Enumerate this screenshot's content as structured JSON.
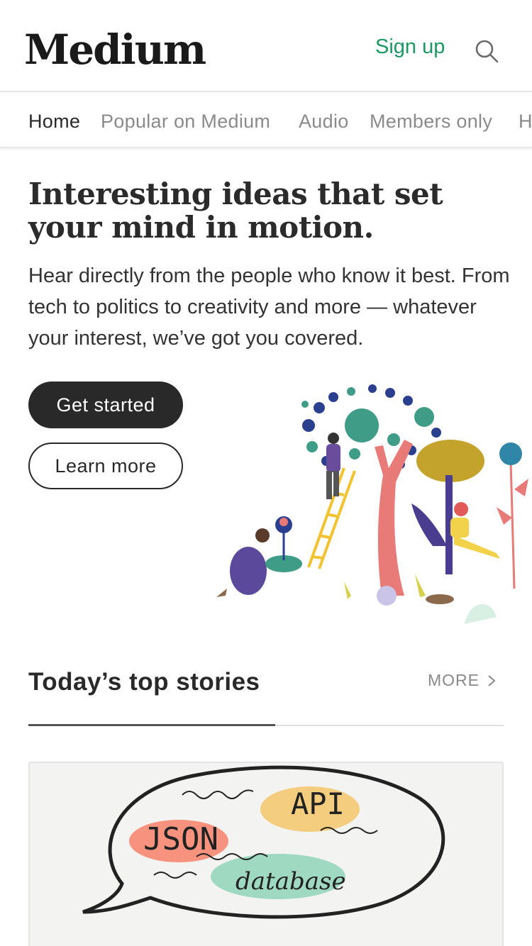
{
  "header": {
    "logo": "Medium",
    "signup_label": "Sign up",
    "search_icon": "search-icon"
  },
  "nav": {
    "items": [
      {
        "label": "Home",
        "active": true
      },
      {
        "label": "Popular on Medium",
        "active": false
      },
      {
        "label": "Audio",
        "active": false
      },
      {
        "label": "Members only",
        "active": false
      },
      {
        "label": "H",
        "active": false
      }
    ]
  },
  "hero": {
    "title": "Interesting ideas that set your mind in motion.",
    "subtitle": "Hear directly from the people who know it best. From tech to politics to creativity and more — whatever your interest, we’ve got you covered.",
    "primary_button": "Get started",
    "secondary_button": "Learn more"
  },
  "top_stories": {
    "title": "Today’s top stories",
    "more_label": "MORE",
    "card": {
      "bubble_words": [
        "API",
        "JSON",
        "database"
      ]
    }
  },
  "colors": {
    "accent": "#1c9963",
    "dark_button": "#292929",
    "muted_text": "#8a8a8a"
  }
}
